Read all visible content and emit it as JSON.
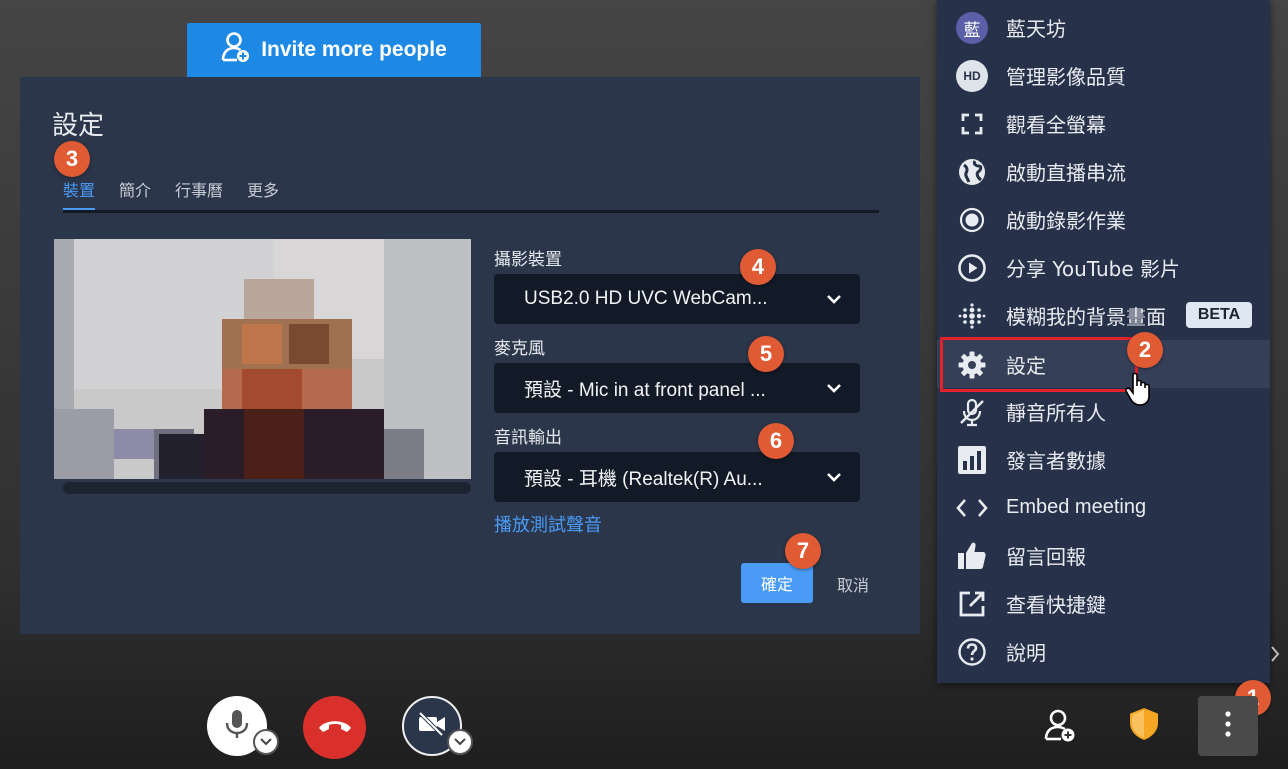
{
  "invite_button": {
    "label": "Invite more people"
  },
  "settings_dialog": {
    "title": "設定",
    "tabs": [
      {
        "label": "裝置",
        "active": true
      },
      {
        "label": "簡介",
        "active": false
      },
      {
        "label": "行事曆",
        "active": false
      },
      {
        "label": "更多",
        "active": false
      }
    ],
    "camera": {
      "label": "攝影裝置",
      "value": "USB2.0 HD UVC WebCam..."
    },
    "microphone": {
      "label": "麥克風",
      "value": "預設 - Mic in at front panel ..."
    },
    "audio_output": {
      "label": "音訊輸出",
      "value": "預設 - 耳機 (Realtek(R) Au..."
    },
    "play_test_sound": "播放測試聲音",
    "ok_label": "確定",
    "cancel_label": "取消"
  },
  "menu": {
    "items": [
      {
        "label": "藍天坊",
        "icon": "avatar",
        "avatar_text": "藍"
      },
      {
        "label": "管理影像品質",
        "icon": "hd-icon",
        "avatar_text": "HD"
      },
      {
        "label": "觀看全螢幕",
        "icon": "fullscreen-icon"
      },
      {
        "label": "啟動直播串流",
        "icon": "globe-icon"
      },
      {
        "label": "啟動錄影作業",
        "icon": "record-icon"
      },
      {
        "label": "分享 YouTube 影片",
        "icon": "play-circle-icon"
      },
      {
        "label": "模糊我的背景畫面",
        "icon": "blur-icon",
        "badge": "BETA"
      },
      {
        "label": "設定",
        "icon": "gear-icon"
      },
      {
        "label": "靜音所有人",
        "icon": "mic-off-icon"
      },
      {
        "label": "發言者數據",
        "icon": "stats-icon"
      },
      {
        "label": "Embed meeting",
        "icon": "code-icon"
      },
      {
        "label": "留言回報",
        "icon": "thumbs-up-icon"
      },
      {
        "label": "查看快捷鍵",
        "icon": "external-link-icon"
      },
      {
        "label": "說明",
        "icon": "help-icon"
      }
    ]
  },
  "step_badges": [
    "1",
    "2",
    "3",
    "4",
    "5",
    "6",
    "7"
  ],
  "colors": {
    "accent": "#4a9bf5",
    "invite_blue": "#1e88e5",
    "dialog_bg": "#2b364a",
    "menu_bg": "#27324a",
    "hangup_red": "#d9302c",
    "badge_orange": "#e05a34",
    "shield_orange": "#f5a623"
  }
}
